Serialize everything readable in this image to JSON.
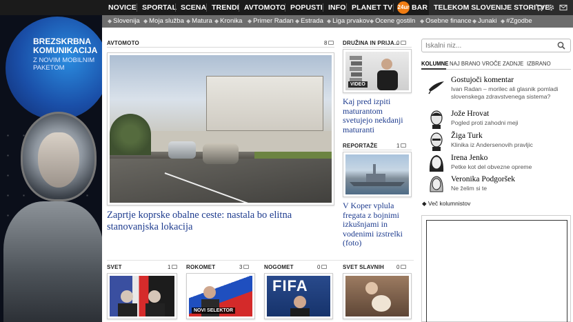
{
  "top_nav": {
    "items": [
      "NOVICE",
      "SPORTAL",
      "SCENA",
      "TRENDI",
      "AVTOMOTO",
      "POPUSTI",
      "INFO",
      "PLANET TV",
      "BAR"
    ],
    "bar_icon": "24ur",
    "telekom_label": "TELEKOM SLOVENIJE STORITVE",
    "icons": [
      "cart-icon",
      "gear-icon",
      "mail-icon"
    ]
  },
  "sub_nav": {
    "items": [
      "Slovenija",
      "Moja služba",
      "Matura",
      "Kronika",
      "Primer Radan",
      "Estrada",
      "Liga prvakov",
      "Ocene gostiln",
      "Osebne finance",
      "Junaki",
      "#Zgodbe"
    ]
  },
  "ad": {
    "title": "BREZSKRBNA KOMUNIKACIJA",
    "subtitle": "Z NOVIM MOBILNIM PAKETOM"
  },
  "sections": {
    "avtomoto": {
      "label": "AVTOMOTO",
      "count": "8",
      "headline": "Zaprtje koprske obalne ceste: nastala bo elitna stanovanjska lokacija"
    },
    "druzina": {
      "label": "DRUŽINA IN PRIJA...",
      "count": "0",
      "badge": "VIDEO",
      "headline": "Kaj pred izpiti maturantom svetujejo nekdanji maturanti"
    },
    "reportaze": {
      "label": "REPORTAŽE",
      "count": "1",
      "headline": "V Koper vplula fregata z bojnimi izkušnjami in vodenimi izstrelki (foto)"
    },
    "svet": {
      "label": "SVET",
      "count": "1"
    },
    "rokomet": {
      "label": "ROKOMET",
      "count": "3",
      "badge": "NOVI SELEKTOR"
    },
    "nogomet": {
      "label": "NOGOMET",
      "count": "0",
      "image_text": "FIFA"
    },
    "svet_slavnih": {
      "label": "SVET SLAVNIH",
      "count": "0"
    }
  },
  "search": {
    "placeholder": "Iskalni niz..."
  },
  "right_tabs": [
    "KOLUMNE",
    "NAJ BRANO",
    "VROČE",
    "ZADNJE",
    "IZBRANO"
  ],
  "columns": [
    {
      "name": "Gostujoči komentar",
      "desc": "Ivan Radan – morilec ali glasnik pomladi slovenskega zdravstvenega sistema?"
    },
    {
      "name": "Jože Hrovat",
      "desc": "Pogled proti zahodni meji"
    },
    {
      "name": "Žiga Turk",
      "desc": "Klinika iz Andersenovih pravljic"
    },
    {
      "name": "Irena Jenko",
      "desc": "Petke kot del obvezne opreme"
    },
    {
      "name": "Veronika Podgoršek",
      "desc": "Ne želim si te"
    }
  ],
  "more_columnists": "Več kolumnistov"
}
